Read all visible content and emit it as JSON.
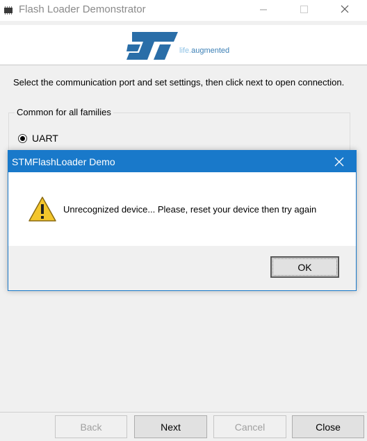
{
  "window": {
    "title": "Flash Loader Demonstrator",
    "controls": [
      "minimize-icon",
      "maximize-icon",
      "close-icon"
    ]
  },
  "banner": {
    "logo": "ST",
    "tagline_a": "life.",
    "tagline_b": "augmented"
  },
  "main": {
    "instruction": "Select the communication port and set settings, then click next to open connection.",
    "group_title": "Common for all families",
    "radio_label": "UART",
    "radio_selected": true
  },
  "buttons": {
    "back": "Back",
    "next": "Next",
    "cancel": "Cancel",
    "close": "Close"
  },
  "dialog": {
    "title": "STMFlashLoader Demo",
    "message": "Unrecognized device... Please, reset your device then try again",
    "ok": "OK",
    "icon": "warning-icon"
  },
  "colors": {
    "dialog_titlebar": "#1979ca",
    "brand_blue": "#3b7fb5"
  }
}
